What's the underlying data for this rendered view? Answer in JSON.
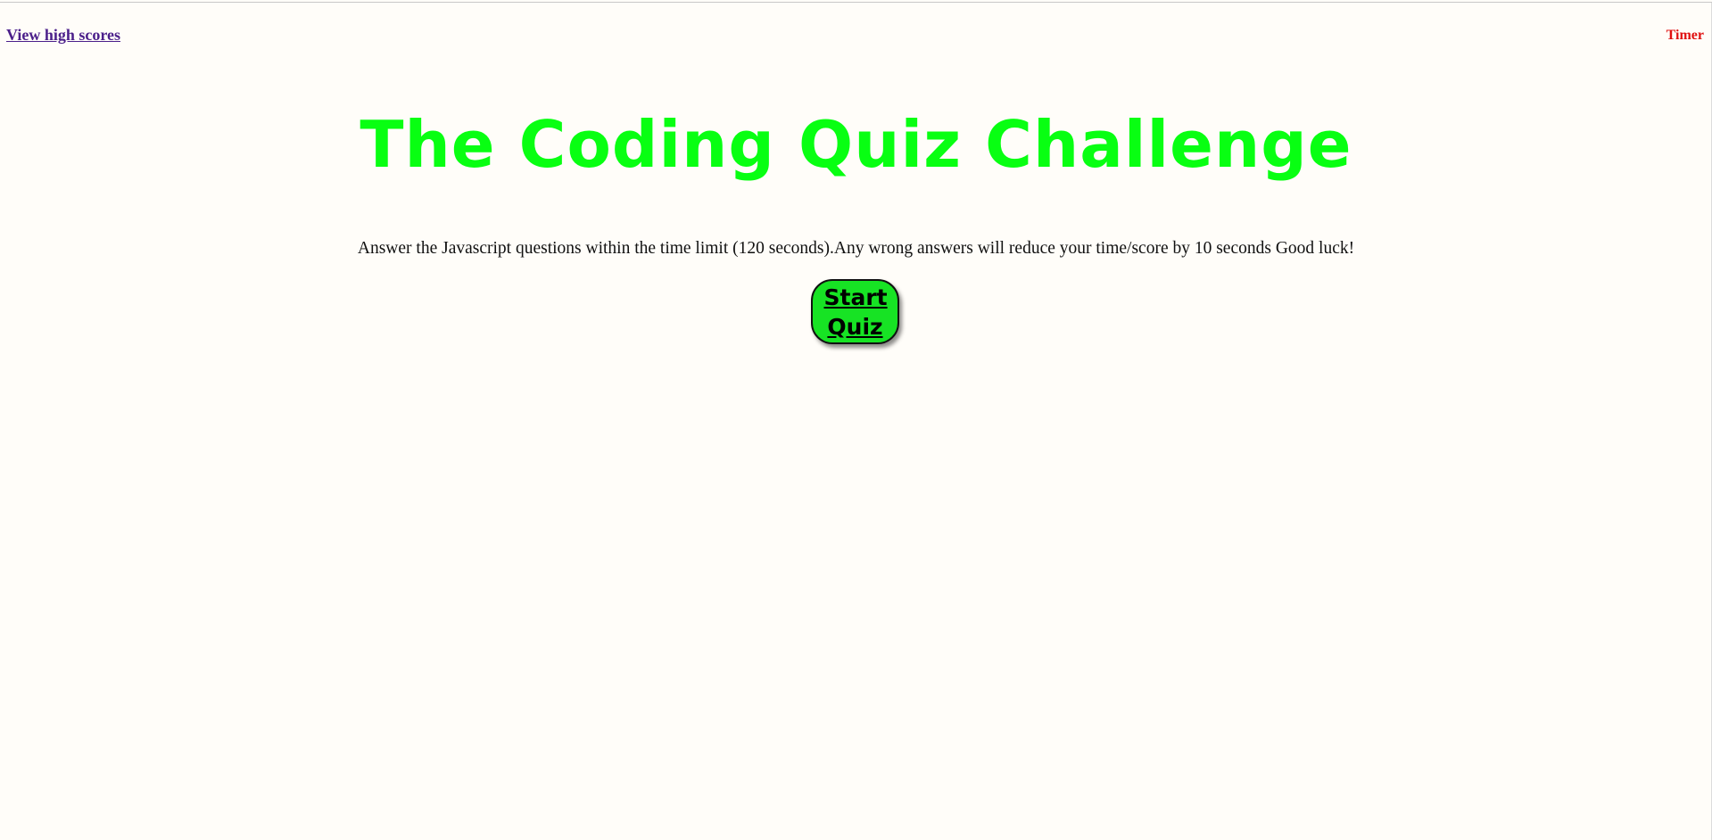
{
  "header": {
    "highscores_label": "View high scores",
    "timer_label": "Timer"
  },
  "main": {
    "title": "The Coding Quiz Challenge",
    "instructions": "Answer the Javascript questions within the time limit (120 seconds).Any wrong answers will reduce your time/score by 10 seconds Good luck!",
    "start_button_label": "Start Quiz"
  },
  "colors": {
    "background": "#fffdf9",
    "title": "#08ff12",
    "link": "#4b1f8a",
    "timer": "#e01010",
    "button": "#17e324"
  }
}
